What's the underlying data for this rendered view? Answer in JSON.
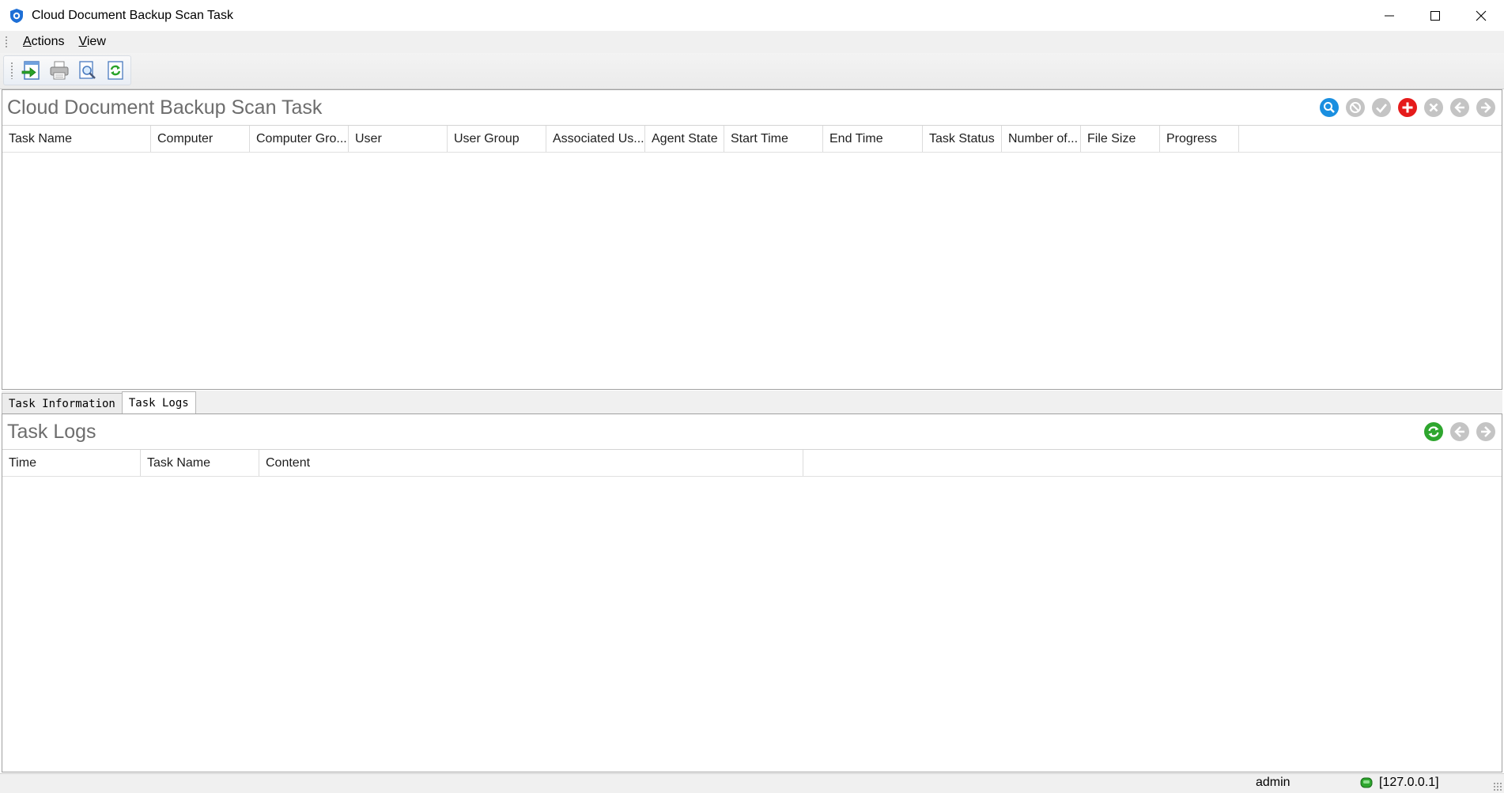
{
  "window": {
    "title": "Cloud Document Backup Scan Task",
    "controls": [
      "minimize-icon",
      "maximize-icon",
      "close-icon"
    ]
  },
  "menu": {
    "items": [
      {
        "label": "Actions",
        "mnemonic": "A",
        "rest": "ctions"
      },
      {
        "label": "View",
        "mnemonic": "V",
        "rest": "iew"
      }
    ]
  },
  "toolbar": {
    "buttons": [
      "export-icon",
      "print-icon",
      "print-preview-icon",
      "refresh-icon"
    ]
  },
  "task_panel": {
    "title": "Cloud Document Backup Scan Task",
    "actions": [
      "search-icon",
      "stop-icon",
      "check-icon",
      "add-icon",
      "delete-icon",
      "previous-icon",
      "next-icon"
    ],
    "columns": [
      "Task Name",
      "Computer",
      "Computer Gro...",
      "User",
      "User Group",
      "Associated Us...",
      "Agent State",
      "Start Time",
      "End Time",
      "Task Status",
      "Number of...",
      "File Size",
      "Progress"
    ],
    "rows": []
  },
  "tabs": [
    {
      "label": "Task Information",
      "active": false
    },
    {
      "label": "Task Logs",
      "active": true
    }
  ],
  "logs_panel": {
    "title": "Task Logs",
    "actions": [
      "refresh-icon",
      "previous-icon",
      "next-icon"
    ],
    "columns": [
      "Time",
      "Task Name",
      "Content"
    ],
    "rows": []
  },
  "status": {
    "user": "admin",
    "connection": "[127.0.0.1]"
  },
  "colors": {
    "accent_blue": "#1a8fe0",
    "add_red": "#e51b1b",
    "refresh_green": "#2ea62e",
    "disabled_gray": "#c4c4c4",
    "title_gray": "#6d6d6d"
  }
}
